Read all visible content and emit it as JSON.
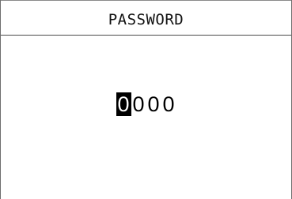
{
  "header": {
    "title": "PASSWORD"
  },
  "password": {
    "digits": [
      "0",
      "0",
      "0",
      "0"
    ],
    "selected_index": 0
  },
  "colors": {
    "background": "#ffffff",
    "text": "#000000",
    "selection_background": "#000000",
    "selection_text": "#ffffff"
  }
}
